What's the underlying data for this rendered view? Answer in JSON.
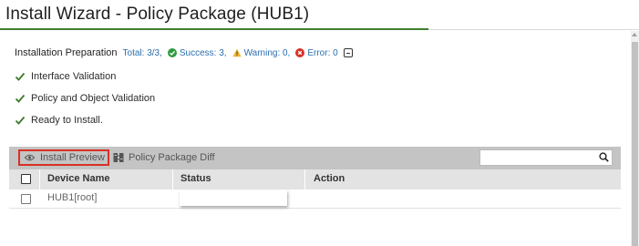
{
  "title": "Install Wizard - Policy Package (HUB1)",
  "colors": {
    "accent_green": "#3f7f2f",
    "link_blue": "#2a6fb0",
    "success_green": "#2e9a3e",
    "warning_yellow": "#f2b632",
    "error_red": "#d93025",
    "check_green": "#3c7a2a",
    "toolbar_bg": "#c4c4c4",
    "header_bg": "#e3e3e3"
  },
  "preparation": {
    "label": "Installation Preparation",
    "total": "Total: 3/3,",
    "success": "Success: 3,",
    "warning": "Warning: 0,",
    "error": "Error: 0",
    "icons": {
      "success": "check-circle-icon",
      "warning": "warning-triangle-icon",
      "error": "error-circle-icon",
      "collapse": "collapse-icon"
    }
  },
  "checks": [
    {
      "label": "Interface Validation",
      "icon": "checkmark-icon"
    },
    {
      "label": "Policy and Object Validation",
      "icon": "checkmark-icon"
    },
    {
      "label": "Ready to Install.",
      "icon": "checkmark-icon"
    }
  ],
  "toolbar": {
    "install_preview": "Install Preview",
    "install_preview_icon": "eye-icon",
    "policy_package_diff": "Policy Package Diff",
    "policy_package_diff_icon": "diff-icon",
    "search_placeholder": "",
    "search_icon": "search-icon"
  },
  "table": {
    "columns": [
      "Device Name",
      "Status",
      "Action"
    ],
    "rows": [
      {
        "device_name": "HUB1[root]",
        "status": "",
        "action": ""
      }
    ]
  }
}
